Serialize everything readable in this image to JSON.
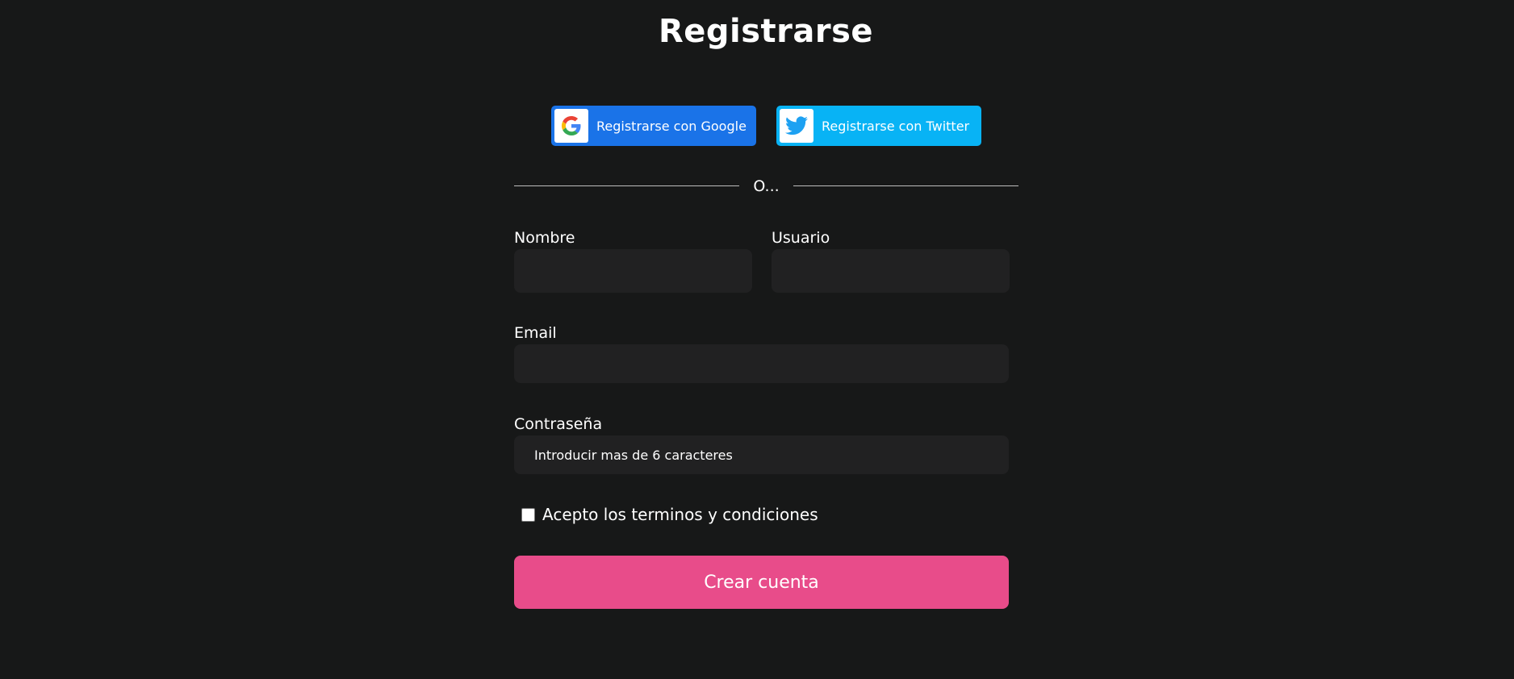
{
  "header": {
    "title": "Registrarse"
  },
  "social": {
    "google": {
      "label": "Registrarse con Google",
      "color": "#1a73e8",
      "icon": "google-icon"
    },
    "twitter": {
      "label": "Registrarse con Twitter",
      "color": "#08b3f5",
      "icon": "twitter-icon"
    }
  },
  "divider": {
    "text": "O..."
  },
  "form": {
    "nombre": {
      "label": "Nombre",
      "value": "",
      "placeholder": ""
    },
    "usuario": {
      "label": "Usuario",
      "value": "",
      "placeholder": ""
    },
    "email": {
      "label": "Email",
      "value": "",
      "placeholder": ""
    },
    "password": {
      "label": "Contraseña",
      "value": "",
      "placeholder": "Introducir mas de 6 caracteres"
    },
    "terms": {
      "label": "Acepto los terminos y condiciones",
      "checked": false
    },
    "submit_label": "Crear cuenta"
  },
  "colors": {
    "background": "#171818",
    "input_background": "#212122",
    "accent": "#e84c8a"
  }
}
